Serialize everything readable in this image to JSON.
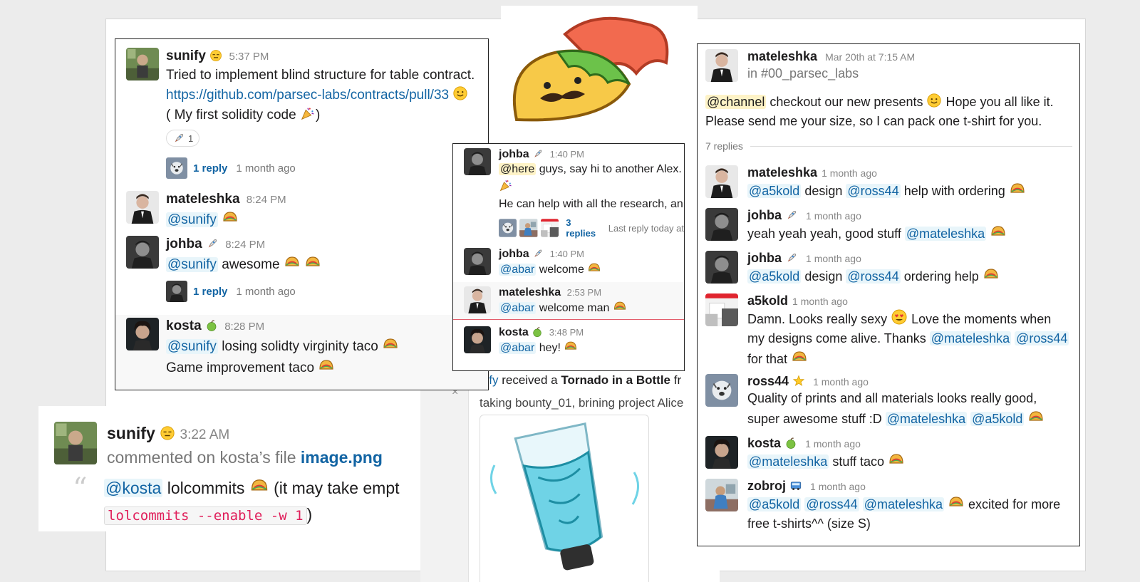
{
  "colors": {
    "link": "#1264a3",
    "mention_bg": "#e8f5fa",
    "here_bg": "#fef3c7",
    "code": "#e01e5a"
  },
  "panel_a": {
    "messages": [
      {
        "name": "sunify",
        "emoji": "expressionless-face",
        "time": "5:37 PM",
        "lines": [
          "Tried to implement blind structure for table contract.",
          "https://github.com/parsec-labs/contracts/pull/33",
          "( My first solidity code"
        ],
        "reaction_count": "1",
        "reply_label": "1 reply",
        "reply_ago": "1 month ago"
      },
      {
        "name": "mateleshka",
        "time": "8:24 PM",
        "mention": "@sunify"
      },
      {
        "name": "johba",
        "emoji": "rocket",
        "time": "8:24 PM",
        "mention": "@sunify",
        "text": "awesome",
        "reply_label": "1 reply",
        "reply_ago": "1 month ago"
      },
      {
        "name": "kosta",
        "emoji": "green-apple",
        "time": "8:28 PM",
        "mention": "@sunify",
        "text": "losing solidty virginity taco",
        "line2": "Game improvement taco"
      }
    ]
  },
  "panel_b": {
    "messages": [
      {
        "name": "johba",
        "time": "1:40 PM",
        "here": "@here",
        "text": "guys, say hi to another Alex.",
        "line2": "He can help with all the research, an",
        "reply_label": "3 replies",
        "reply_ago": "Last reply today at"
      },
      {
        "name": "johba",
        "time": "1:40 PM",
        "mention": "@abar",
        "text": "welcome"
      },
      {
        "name": "mateleshka",
        "time": "2:53 PM",
        "mention": "@abar",
        "text": "welcome man"
      },
      {
        "name": "kosta",
        "time": "3:48 PM",
        "mention": "@abar",
        "text": "hey!"
      }
    ]
  },
  "panel_c": {
    "root": {
      "name": "mateleshka",
      "time": "Mar 20th at 7:15 AM",
      "channel": "in #00_parsec_labs",
      "mention": "@channel",
      "text1": "checkout our new presents",
      "text2": "Hope you all like it.",
      "line2": "Please send me your size, so I can pack one t-shirt for you."
    },
    "replies_label": "7 replies",
    "replies": [
      {
        "name": "mateleshka",
        "time": "1 month ago",
        "m1": "@a5kold",
        "t1": "design",
        "m2": "@ross44",
        "t2": "help with ordering"
      },
      {
        "name": "johba",
        "time": "1 month ago",
        "t1": "yeah yeah yeah, good stuff",
        "m1": "@mateleshka"
      },
      {
        "name": "johba",
        "time": "1 month ago",
        "m1": "@a5kold",
        "t1": "design",
        "m2": "@ross44",
        "t2": "ordering help"
      },
      {
        "name": "a5kold",
        "time": "1 month ago",
        "l1a": "Damn. Looks really sexy",
        "l1b": "Love the moments when",
        "l2a": "my designs come alive. Thanks",
        "m1": "@mateleshka",
        "m2": "@ross44",
        "l3": "for that"
      },
      {
        "name": "ross44",
        "time": "1 month ago",
        "l1": "Quality of prints and all materials looks really good,",
        "l2": "super awesome stuff :D",
        "m1": "@mateleshka",
        "m2": "@a5kold"
      },
      {
        "name": "kosta",
        "time": "1 month ago",
        "m1": "@mateleshka",
        "t1": "stuff taco"
      },
      {
        "name": "zobroj",
        "time": "1 month ago",
        "m1": "@a5kold",
        "m2": "@ross44",
        "m3": "@mateleshka",
        "t1": "excited for more",
        "l2": "free t-shirts^^ (size S)"
      }
    ]
  },
  "panel_d": {
    "name": "sunify",
    "time": "3:22 AM",
    "commented": "commented on kosta’s file",
    "file": "image.png",
    "mention": "@kosta",
    "text": "lolcommits",
    "text2": "(it may take empt",
    "code": "lolcommits --enable -w 1",
    "close": ")"
  },
  "bounty": {
    "mention": "nify",
    "received": "received a",
    "item": "Tornado in a Bottle",
    "tail": "fr",
    "line2": "taking bounty_01, brining project Alice",
    "close": "×"
  }
}
